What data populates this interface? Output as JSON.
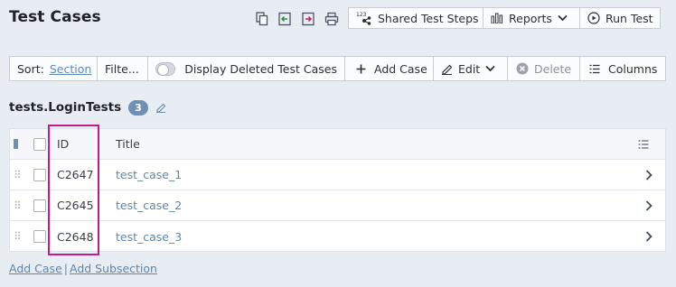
{
  "header": {
    "title": "Test Cases",
    "icons": [
      "copy-icon",
      "export-icon",
      "import-icon",
      "print-icon"
    ],
    "shared_steps_label": "Shared Test Steps",
    "reports_label": "Reports",
    "run_test_label": "Run Test"
  },
  "toolbar": {
    "sort_label": "Sort:",
    "sort_value": "Section",
    "filter_label": "Filte...",
    "display_deleted_label": "Display Deleted Test Cases",
    "display_deleted_on": false,
    "add_case_label": "Add Case",
    "edit_label": "Edit",
    "delete_label": "Delete",
    "columns_label": "Columns"
  },
  "section": {
    "name": "tests.LoginTests",
    "count": "3"
  },
  "grid": {
    "columns": {
      "id": "ID",
      "title": "Title"
    },
    "rows": [
      {
        "id": "C2647",
        "title": "test_case_1"
      },
      {
        "id": "C2645",
        "title": "test_case_2"
      },
      {
        "id": "C2648",
        "title": "test_case_3"
      }
    ]
  },
  "footer": {
    "add_case": "Add Case",
    "separator": "|",
    "add_subsection": "Add Subsection"
  },
  "colors": {
    "background": "#e8edf4",
    "link": "#5e86a9",
    "badge": "#6f8fb5",
    "highlight": "#c01d8a"
  }
}
